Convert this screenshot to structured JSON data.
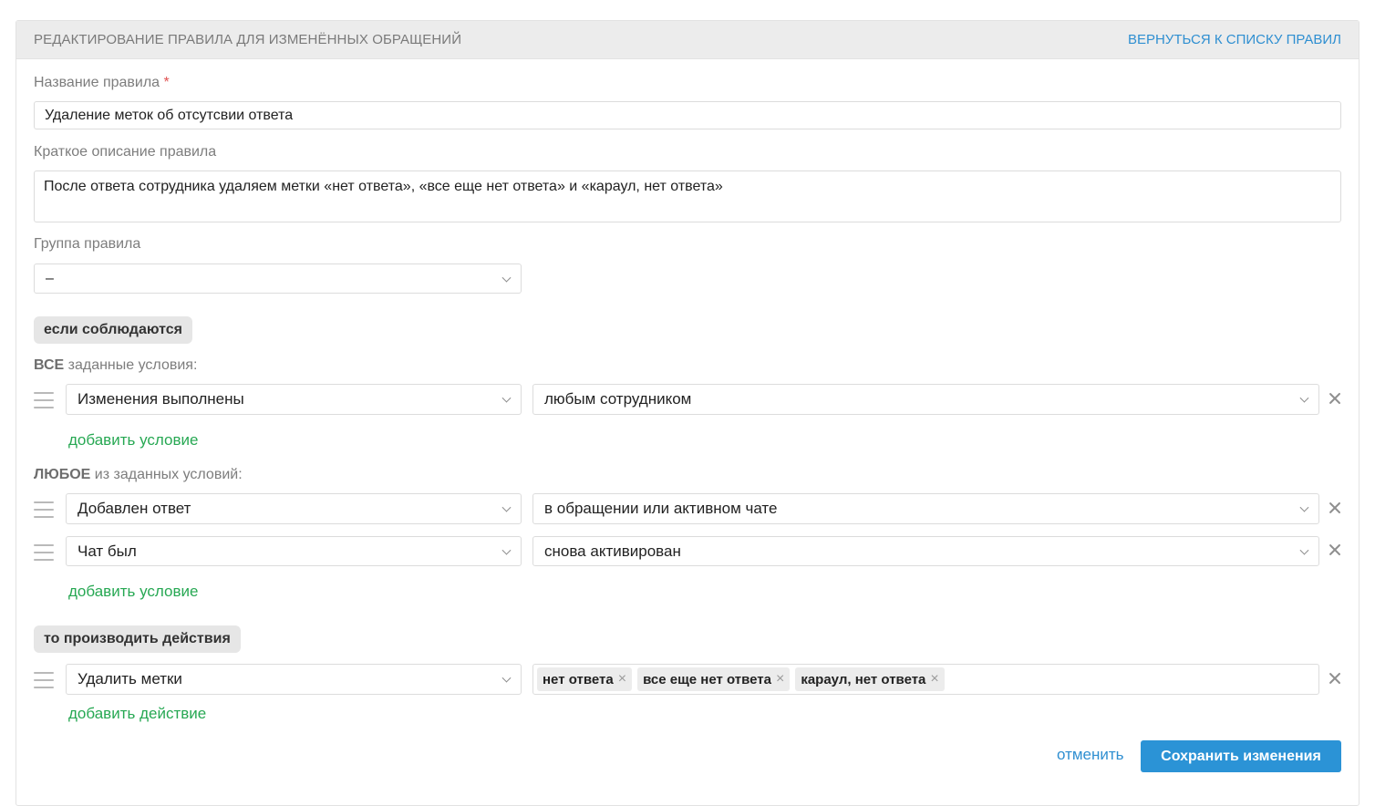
{
  "header": {
    "title": "РЕДАКТИРОВАНИЕ ПРАВИЛА ДЛЯ ИЗМЕНЁННЫХ ОБРАЩЕНИЙ",
    "back_link": "ВЕРНУТЬСЯ К СПИСКУ ПРАВИЛ"
  },
  "form": {
    "name_label": "Название правила",
    "required_mark": "*",
    "name_value": "Удаление меток об отсутсвии ответа",
    "description_label": "Краткое описание правила",
    "description_value": "После ответа сотрудника удаляем метки «нет ответа»,  «все еще нет ответа» и «караул, нет ответа»",
    "group_label": "Группа правила",
    "group_value": "–"
  },
  "conditions": {
    "section_label": "если соблюдаются",
    "all": {
      "prefix": "ВСЕ",
      "suffix": " заданные условия:",
      "rows": [
        {
          "field": "Изменения выполнены",
          "value": "любым сотрудником"
        }
      ],
      "add_label": "добавить условие"
    },
    "any": {
      "prefix": "ЛЮБОЕ",
      "suffix": " из заданных условий:",
      "rows": [
        {
          "field": "Добавлен ответ",
          "value": "в обращении или активном чате"
        },
        {
          "field": "Чат был",
          "value": "снова активирован"
        }
      ],
      "add_label": "добавить условие"
    }
  },
  "actions": {
    "section_label": "то производить действия",
    "rows": [
      {
        "field": "Удалить метки",
        "tags": [
          "нет ответа",
          "все еще нет ответа",
          "караул, нет ответа"
        ]
      }
    ],
    "add_label": "добавить действие"
  },
  "footer": {
    "cancel_label": "отменить",
    "save_label": "Сохранить изменения"
  },
  "icons": {
    "tag_remove": "×"
  },
  "colors": {
    "accent_blue": "#2b93d6",
    "link_green": "#27a853",
    "required_red": "#e05252"
  }
}
